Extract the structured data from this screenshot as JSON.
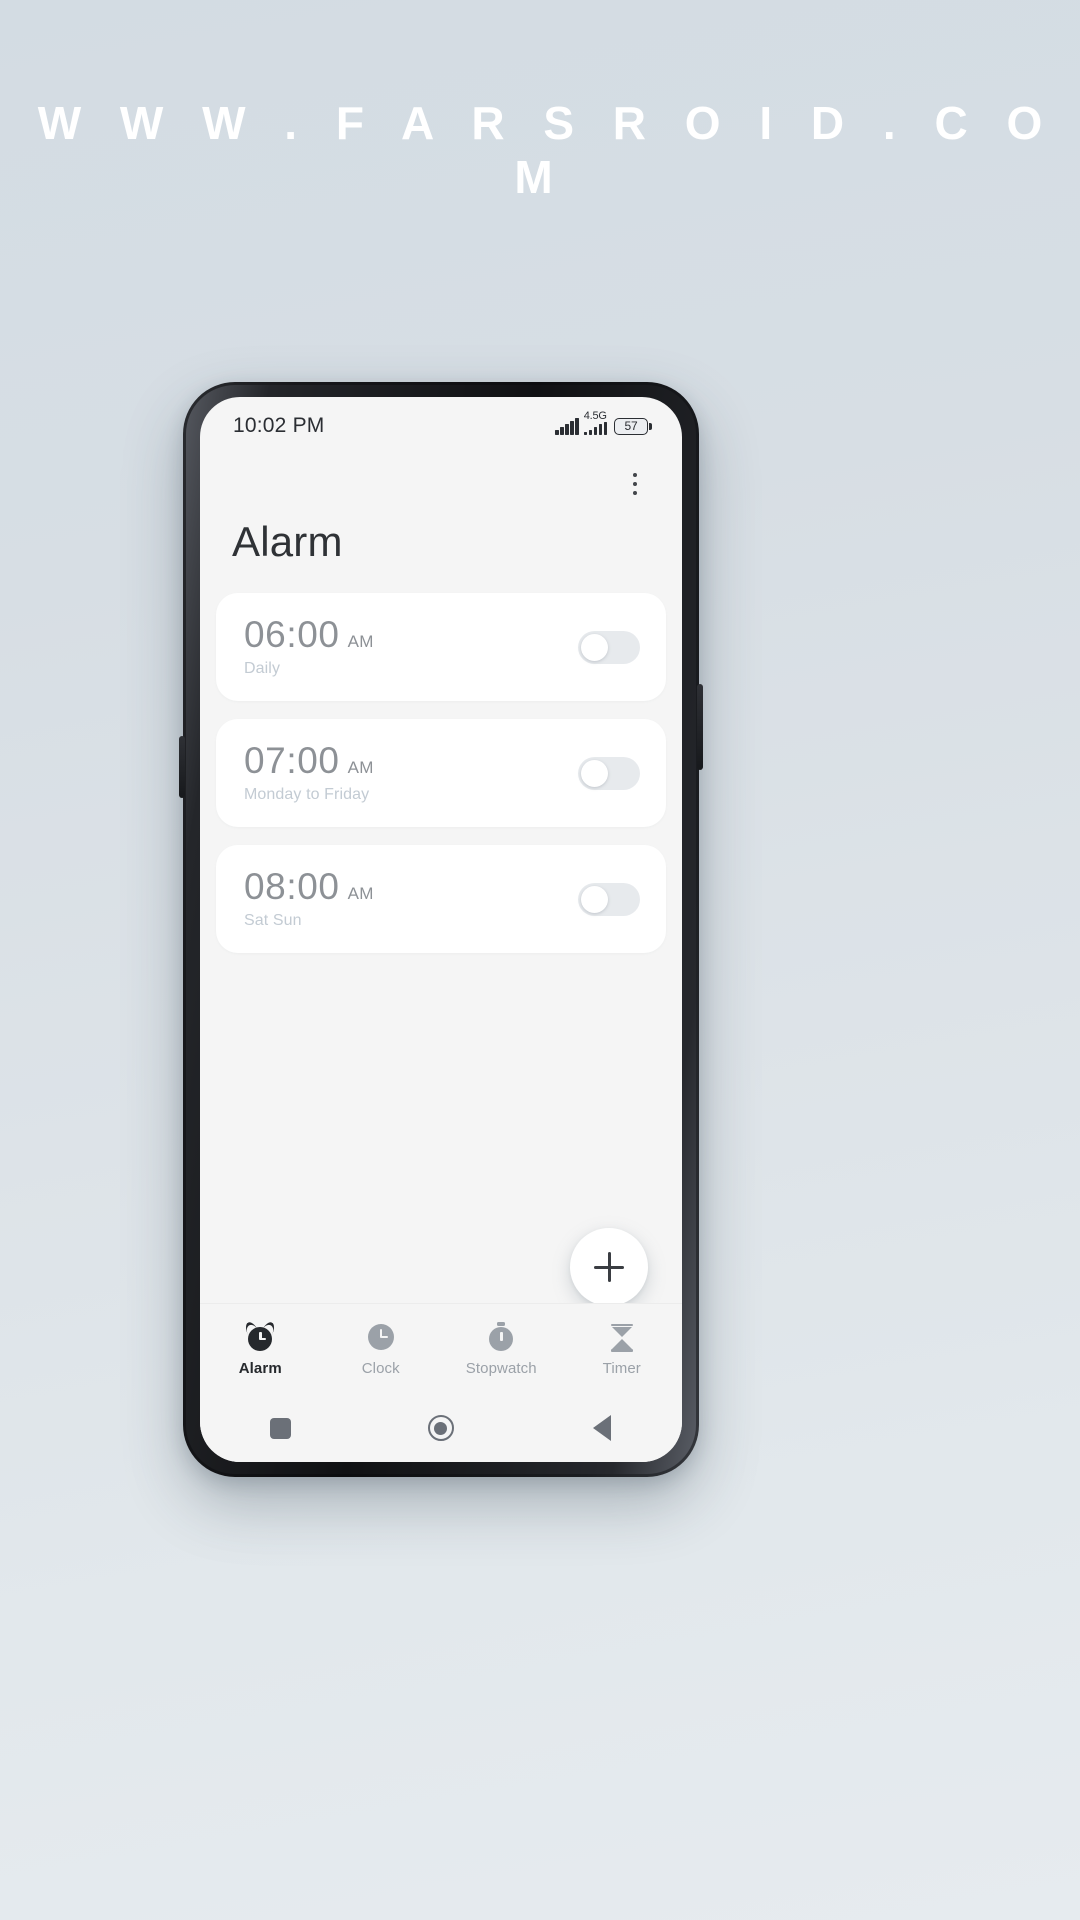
{
  "watermark": "W W W . F A R S R O I D . C O M",
  "status_bar": {
    "time": "10:02 PM",
    "network_label": "4.5G",
    "battery_level": "57",
    "signal_icon": "signal-bars-icon",
    "battery_icon": "battery-icon"
  },
  "header": {
    "title": "Alarm",
    "overflow_icon": "more-vertical-icon"
  },
  "alarms": [
    {
      "time": "06:00",
      "meridiem": "AM",
      "repeat": "Daily",
      "enabled": false
    },
    {
      "time": "07:00",
      "meridiem": "AM",
      "repeat": "Monday to Friday",
      "enabled": false
    },
    {
      "time": "08:00",
      "meridiem": "AM",
      "repeat": "Sat Sun",
      "enabled": false
    }
  ],
  "fab": {
    "label": "+",
    "icon": "plus-icon"
  },
  "tabs": [
    {
      "label": "Alarm",
      "icon": "alarm-clock-icon",
      "active": true
    },
    {
      "label": "Clock",
      "icon": "clock-icon",
      "active": false
    },
    {
      "label": "Stopwatch",
      "icon": "stopwatch-icon",
      "active": false
    },
    {
      "label": "Timer",
      "icon": "hourglass-icon",
      "active": false
    }
  ],
  "system_nav": {
    "recents_icon": "square-recents-icon",
    "home_icon": "circle-home-icon",
    "back_icon": "triangle-back-icon"
  },
  "colors": {
    "accent": "#26292d",
    "muted": "#9ba1a8",
    "card": "#ffffff",
    "screen_bg": "#f5f5f5"
  }
}
